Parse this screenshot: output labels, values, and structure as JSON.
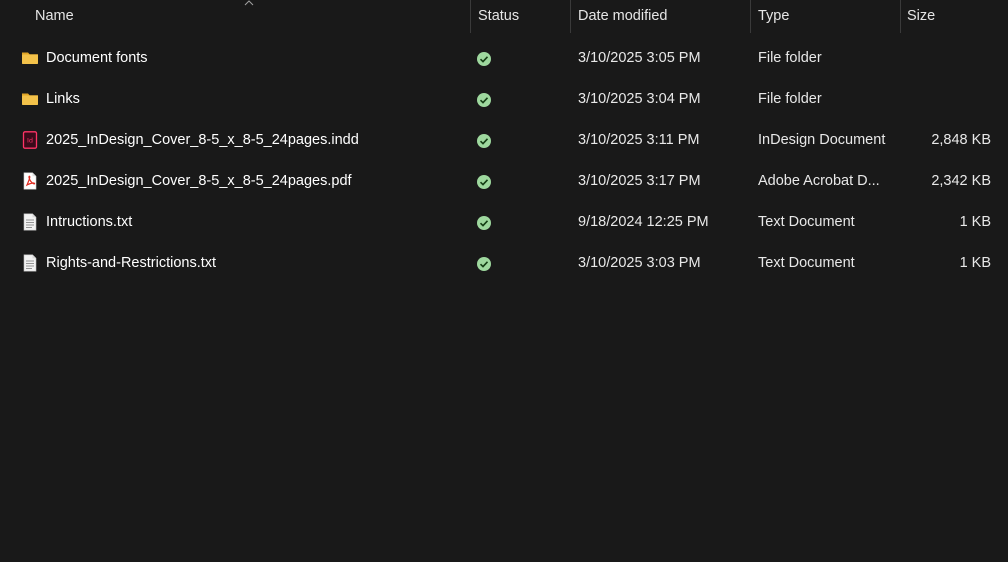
{
  "columns": {
    "name": "Name",
    "status": "Status",
    "date": "Date modified",
    "type": "Type",
    "size": "Size"
  },
  "colors": {
    "background": "#191919",
    "status_ok": "#9ed89e",
    "folder": "#f3c24a",
    "indesign": "#ff3366",
    "acrobat": "#e02b20"
  },
  "files": [
    {
      "icon": "folder-icon",
      "name": "Document fonts",
      "status": "synced-check-icon",
      "date": "3/10/2025 3:05 PM",
      "type": "File folder",
      "size": ""
    },
    {
      "icon": "folder-icon",
      "name": "Links",
      "status": "synced-check-icon",
      "date": "3/10/2025 3:04 PM",
      "type": "File folder",
      "size": ""
    },
    {
      "icon": "indesign-file-icon",
      "name": "2025_InDesign_Cover_8-5_x_8-5_24pages.indd",
      "status": "synced-check-icon",
      "date": "3/10/2025 3:11 PM",
      "type": "InDesign Document",
      "size": "2,848 KB"
    },
    {
      "icon": "pdf-file-icon",
      "name": "2025_InDesign_Cover_8-5_x_8-5_24pages.pdf",
      "status": "synced-check-icon",
      "date": "3/10/2025 3:17 PM",
      "type": "Adobe Acrobat D...",
      "size": "2,342 KB"
    },
    {
      "icon": "text-file-icon",
      "name": "Intructions.txt",
      "status": "synced-check-icon",
      "date": "9/18/2024 12:25 PM",
      "type": "Text Document",
      "size": "1 KB"
    },
    {
      "icon": "text-file-icon",
      "name": "Rights-and-Restrictions.txt",
      "status": "synced-check-icon",
      "date": "3/10/2025 3:03 PM",
      "type": "Text Document",
      "size": "1 KB"
    }
  ]
}
